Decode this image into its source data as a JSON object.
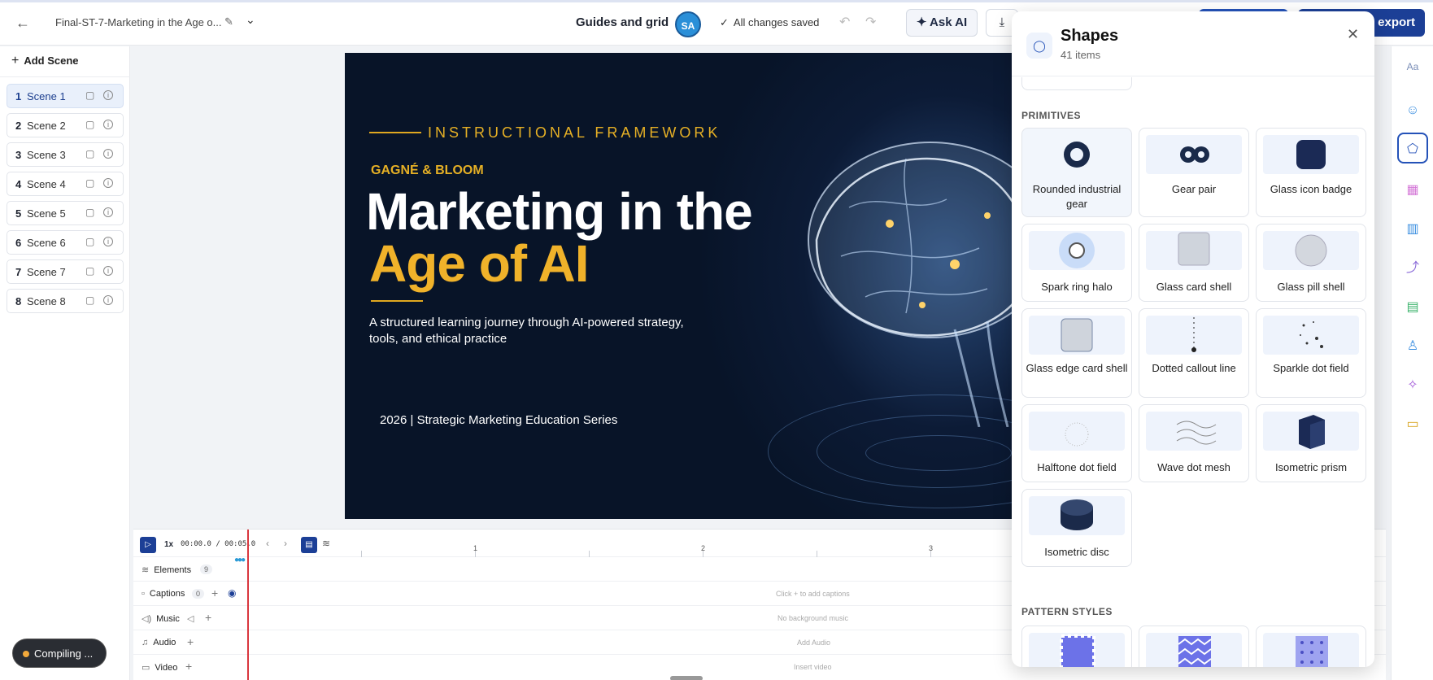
{
  "header": {
    "back_icon": "arrow-left-icon",
    "file_title": "Final-ST-7-Marketing in the Age o...",
    "guides_label": "Guides and grid",
    "avatar_initials": "SA",
    "save_status": "All changes saved",
    "ask_ai_label": "Ask AI",
    "export_label": "export"
  },
  "sidebar": {
    "add_scene_label": "Add Scene",
    "scenes": [
      {
        "num": "1",
        "label": "Scene 1",
        "active": true
      },
      {
        "num": "2",
        "label": "Scene 2"
      },
      {
        "num": "3",
        "label": "Scene 3"
      },
      {
        "num": "4",
        "label": "Scene 4"
      },
      {
        "num": "5",
        "label": "Scene 5"
      },
      {
        "num": "6",
        "label": "Scene 6"
      },
      {
        "num": "7",
        "label": "Scene 7"
      },
      {
        "num": "8",
        "label": "Scene 8"
      }
    ]
  },
  "slide": {
    "kicker": "INSTRUCTIONAL FRAMEWORK",
    "subtitle": "GAGNÉ & BLOOM",
    "title_line1": "Marketing in the",
    "title_line2": "Age of AI",
    "description": "A structured learning journey through AI-powered strategy, tools, and ethical practice",
    "footer": "2026 | Strategic Marketing Education Series",
    "accent_color": "#f0b22a",
    "background_color": "#081428"
  },
  "timeline": {
    "speed": "1x",
    "time_display": "00:00.0 / 00:05.0",
    "ruler": [
      "1",
      "2",
      "3"
    ],
    "tracks": {
      "elements": {
        "label": "Elements",
        "count": "9"
      },
      "captions": {
        "label": "Captions",
        "count": "0",
        "hint": "Click + to add captions"
      },
      "music": {
        "label": "Music",
        "hint": "No background music"
      },
      "audio": {
        "label": "Audio",
        "hint": "Add Audio"
      },
      "video": {
        "label": "Video",
        "hint": "Insert video"
      }
    }
  },
  "toast": {
    "label": "Compiling ..."
  },
  "panel": {
    "title": "Shapes",
    "count": "41 items",
    "sections": {
      "primitives": "PRIMITIVES",
      "patterns": "PATTERN STYLES"
    },
    "primitives": [
      "Rounded industrial gear",
      "Gear pair",
      "Glass icon badge",
      "Spark ring halo",
      "Glass card shell",
      "Glass pill shell",
      "Glass edge card shell",
      "Dotted callout line",
      "Sparkle dot field",
      "Halftone dot field",
      "Wave dot mesh",
      "Isometric prism",
      "Isometric disc"
    ]
  },
  "rail": [
    "text-icon",
    "emoji-icon",
    "shapes-icon",
    "grid-icon",
    "chart-icon",
    "connector-icon",
    "table-icon",
    "avatar-icon",
    "cursor-sparkle-icon",
    "caption-icon"
  ]
}
